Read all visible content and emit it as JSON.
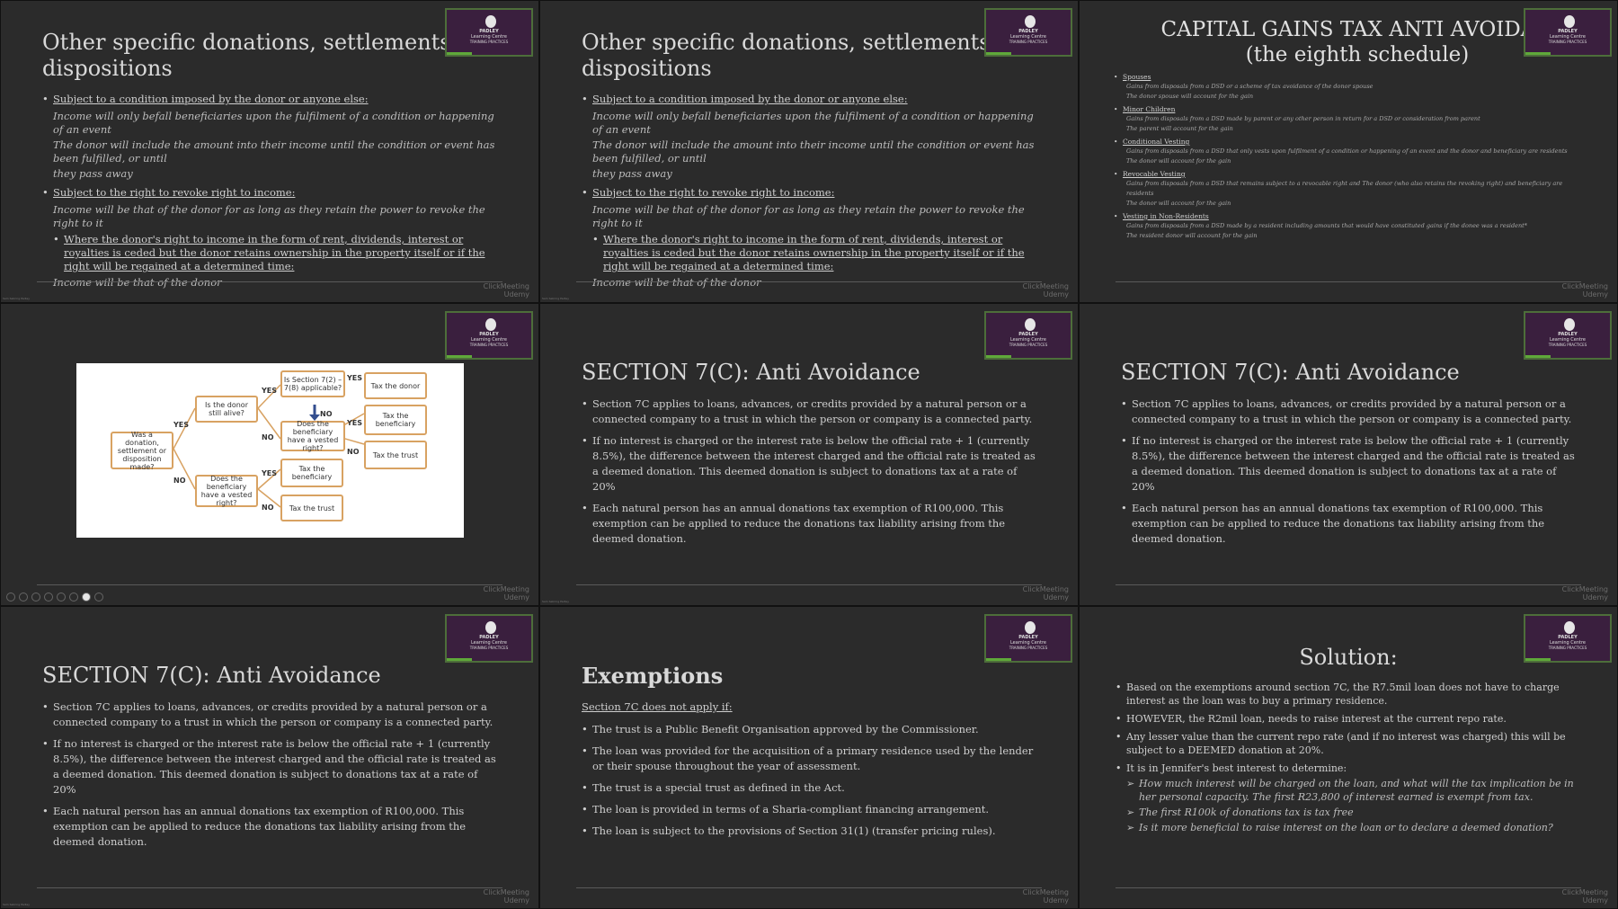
{
  "watermark": {
    "brand": "ClickMeeting",
    "app": "Udemy"
  },
  "logo": {
    "line1": "PADLEY",
    "line2": "Learning Centre",
    "line3": "TRAINING PRACTICES"
  },
  "corner_text": "Sam Sebring Padley",
  "tiles": [
    {
      "type": "bullets",
      "title": "Other specific donations, settlements or dispositions",
      "items": [
        {
          "head": "Subject to a condition imposed by the donor or anyone else:",
          "lines": [
            "Income will only befall beneficiaries upon the fulfilment of a condition or happening of an event",
            "The donor will include the amount into their income until the condition or event has been fulfilled, or until",
            "they pass away"
          ]
        },
        {
          "head": "Subject to the right to revoke right to income:",
          "lines": [
            "Income will be that of the donor for as long as they retain the power to revoke the right to it"
          ]
        }
      ],
      "sub": "Where the donor's right to income in the form of rent, dividends, interest or royalties is ceded but the donor retains ownership in the property itself or if the right will be regained at a determined time:",
      "sub_tail": "Income will be that of the donor"
    },
    {
      "type": "bullets",
      "title": "Other specific donations, settlements or dispositions",
      "items": [
        {
          "head": "Subject to a condition imposed by the donor or anyone else:",
          "lines": [
            "Income will only befall beneficiaries upon the fulfilment of a condition or happening of an event",
            "The donor will include the amount into their income until the condition or event has been fulfilled, or until",
            "they pass away"
          ]
        },
        {
          "head": "Subject to the right to revoke right to income:",
          "lines": [
            "Income will be that of the donor for as long as they retain the power to revoke the right to it"
          ]
        }
      ],
      "sub": "Where the donor's right to income in the form of rent, dividends, interest or royalties is ceded but the donor retains ownership in the property itself or if the right will be regained at a determined time:",
      "sub_tail": "Income will be that of the donor"
    },
    {
      "type": "cgt",
      "title": "CAPITAL GAINS TAX ANTI AVOIDAN",
      "subtitle": "(the eighth schedule)",
      "sections": [
        {
          "head": "Spouses",
          "lines": [
            "Gains from disposals from a DSD or a scheme of tax avoidance of the donor spouse",
            "The donor spouse will account for the gain"
          ]
        },
        {
          "head": "Minor Children",
          "lines": [
            "Gains from disposals from a DSD made by parent or any other person in return for a DSD or consideration from parent",
            "The parent will account for the gain"
          ]
        },
        {
          "head": "Conditional Vesting",
          "lines": [
            "Gains from disposals from a DSD that only vests upon fulfilment of a condition or happening of an event and the donor and beneficiary are residents",
            "The donor will account for the gain"
          ]
        },
        {
          "head": "Revocable Vesting",
          "lines": [
            "Gains from disposals from a DSD that remains subject to a revocable right and The donor (who also retains the revoking right) and beneficiary are residents",
            "The donor will account for the gain"
          ]
        },
        {
          "head": "Vesting in Non-Residents",
          "lines": [
            "Gains from disposals from a DSD made by a resident including amounts that would have constituted gains if the donee was a resident*",
            "The resident donor will account for the gain"
          ]
        }
      ]
    },
    {
      "type": "diagram",
      "boxes": {
        "made": "Was a donation, settlement or disposition made?",
        "alive": "Is the donor still alive?",
        "s72": "Is Section 7(2) – 7(8) applicable?",
        "tax_donor": "Tax the donor",
        "vested1": "Does the beneficiary have a vested right?",
        "tax_ben1": "Tax the beneficiary",
        "tax_trust1": "Tax the trust",
        "vested2": "Does the beneficiary have a vested right?",
        "tax_ben2": "Tax the beneficiary",
        "tax_trust2": "Tax the trust"
      },
      "yes": "YES",
      "no": "NO"
    },
    {
      "type": "s7",
      "title": "SECTION 7(C): Anti Avoidance",
      "items": [
        "Section 7C applies to loans, advances, or credits provided by a natural person or a connected company to a trust in which the person or company is a connected party.",
        "If no interest is charged or the interest rate is below the official rate + 1 (currently 8.5%), the difference between the interest charged and the official rate is treated as a deemed donation. This deemed donation is subject to donations tax at a rate of 20%",
        "Each natural person has an annual donations tax exemption of R100,000. This exemption can be applied to reduce the donations tax liability arising from the deemed donation."
      ]
    },
    {
      "type": "s7",
      "title": "SECTION 7(C): Anti Avoidance",
      "items": [
        "Section 7C applies to loans, advances, or credits provided by a natural person or a connected company to a trust in which the person or company is a connected party.",
        "If no interest is charged or the interest rate is below the official rate + 1 (currently 8.5%), the difference between the interest charged and the official rate is treated as a deemed donation. This deemed donation is subject to donations tax at a rate of 20%",
        "Each natural person has an annual donations tax exemption of R100,000. This exemption can be applied to reduce the donations tax liability arising from the deemed donation."
      ]
    },
    {
      "type": "s7",
      "title": "SECTION 7(C): Anti Avoidance",
      "items": [
        "Section 7C applies to loans, advances, or credits provided by a natural person or a connected company to a trust in which the person or company is a connected party.",
        "If no interest is charged or the interest rate is below the official rate + 1 (currently 8.5%), the difference between the interest charged and the official rate is treated as a deemed donation. This deemed donation is subject to donations tax at a rate of 20%",
        "Each natural person has an annual donations tax exemption of R100,000. This exemption can be applied to reduce the donations tax liability arising from the deemed donation."
      ]
    },
    {
      "type": "exemptions",
      "title": "Exemptions",
      "lead": "Section 7C does not apply if:",
      "items": [
        "The trust is a Public Benefit Organisation approved by the Commissioner.",
        "The loan was provided for the acquisition of a primary residence used by the lender or their spouse throughout the year of assessment.",
        "The trust is a special trust as defined in the Act.",
        "The loan is provided in terms of a Sharia-compliant financing arrangement.",
        "The loan is subject to the provisions of Section 31(1) (transfer pricing rules)."
      ]
    },
    {
      "type": "solution",
      "title": "Solution:",
      "items": [
        "Based on the exemptions around section 7C, the R7.5mil loan does not have to charge interest as the loan was to buy a primary residence.",
        "HOWEVER, the R2mil loan, needs to raise interest at the current repo rate.",
        "Any lesser value than the current repo rate (and if no interest was charged) this will be subject to a DEEMED donation at 20%.",
        "It is in Jennifer's best interest to determine:"
      ],
      "subitems": [
        "How much interest will be charged on the loan, and what will the tax implication be in her personal capacity. The first R23,800 of interest earned is exempt from tax.",
        "The first R100k of donations tax is tax free",
        "Is it more beneficial to raise interest on the loan or to declare a deemed donation?"
      ]
    }
  ]
}
